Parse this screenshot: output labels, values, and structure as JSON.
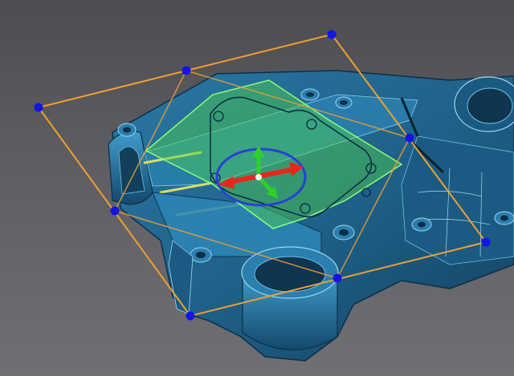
{
  "viewport": {
    "background_top": "#4d4d51",
    "background_bottom": "#6f6f74"
  },
  "part": {
    "body_color": "#1e5f86",
    "highlight_color": "#4aa0c8",
    "edge_color": "#9fd8f0",
    "shadow_color": "#0f3550"
  },
  "section_plane": {
    "fill_color": "#4fd34a",
    "fill_opacity": 0.45,
    "edge_color": "#8cff78"
  },
  "bounding_frame": {
    "line_color": "#f0a030",
    "handle_color": "#1414e6",
    "handle_icon": "circle-handle"
  },
  "gizmo": {
    "x_axis_color": "#e8261c",
    "y_axis_color": "#2ed12a",
    "z_axis_color": "#2e5cd8",
    "ring_color": "#2a3fd6",
    "icon": "move-rotate-gizmo-icon"
  }
}
